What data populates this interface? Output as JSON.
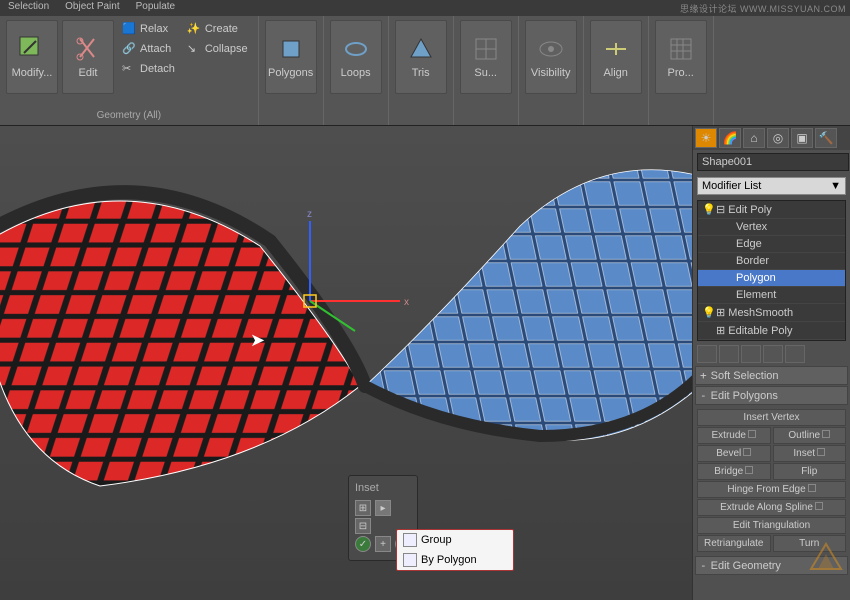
{
  "tabs": {
    "selection": "Selection",
    "object_paint": "Object Paint",
    "populate": "Populate"
  },
  "ribbon": {
    "modify": "Modify...",
    "edit": "Edit",
    "relax": "Relax",
    "create": "Create",
    "attach": "Attach",
    "collapse": "Collapse",
    "detach": "Detach",
    "geometry_all": "Geometry (All)",
    "polygons": "Polygons",
    "loops": "Loops",
    "tris": "Tris",
    "subdivision": "Su...",
    "visibility": "Visibility",
    "align": "Align",
    "properties": "Pro..."
  },
  "panel": {
    "object_name": "Shape001",
    "modifier_list": "Modifier List",
    "stack": {
      "edit_poly": "Edit Poly",
      "vertex": "Vertex",
      "edge": "Edge",
      "border": "Border",
      "polygon": "Polygon",
      "element": "Element",
      "meshsmooth": "MeshSmooth",
      "editable_poly": "Editable Poly"
    },
    "rollouts": {
      "soft_selection": "Soft Selection",
      "edit_polygons": "Edit Polygons",
      "insert_vertex": "Insert Vertex",
      "extrude": "Extrude",
      "outline": "Outline",
      "bevel": "Bevel",
      "inset": "Inset",
      "bridge": "Bridge",
      "flip": "Flip",
      "hinge": "Hinge From Edge",
      "extrude_spline": "Extrude Along Spline",
      "edit_tri": "Edit Triangulation",
      "retriangulate": "Retriangulate",
      "turn": "Turn",
      "edit_geometry": "Edit Geometry"
    }
  },
  "popup": {
    "title": "Inset"
  },
  "context": {
    "group": "Group",
    "by_polygon": "By Polygon"
  },
  "watermark": "思缘设计论坛 WWW.MISSYUAN.COM"
}
